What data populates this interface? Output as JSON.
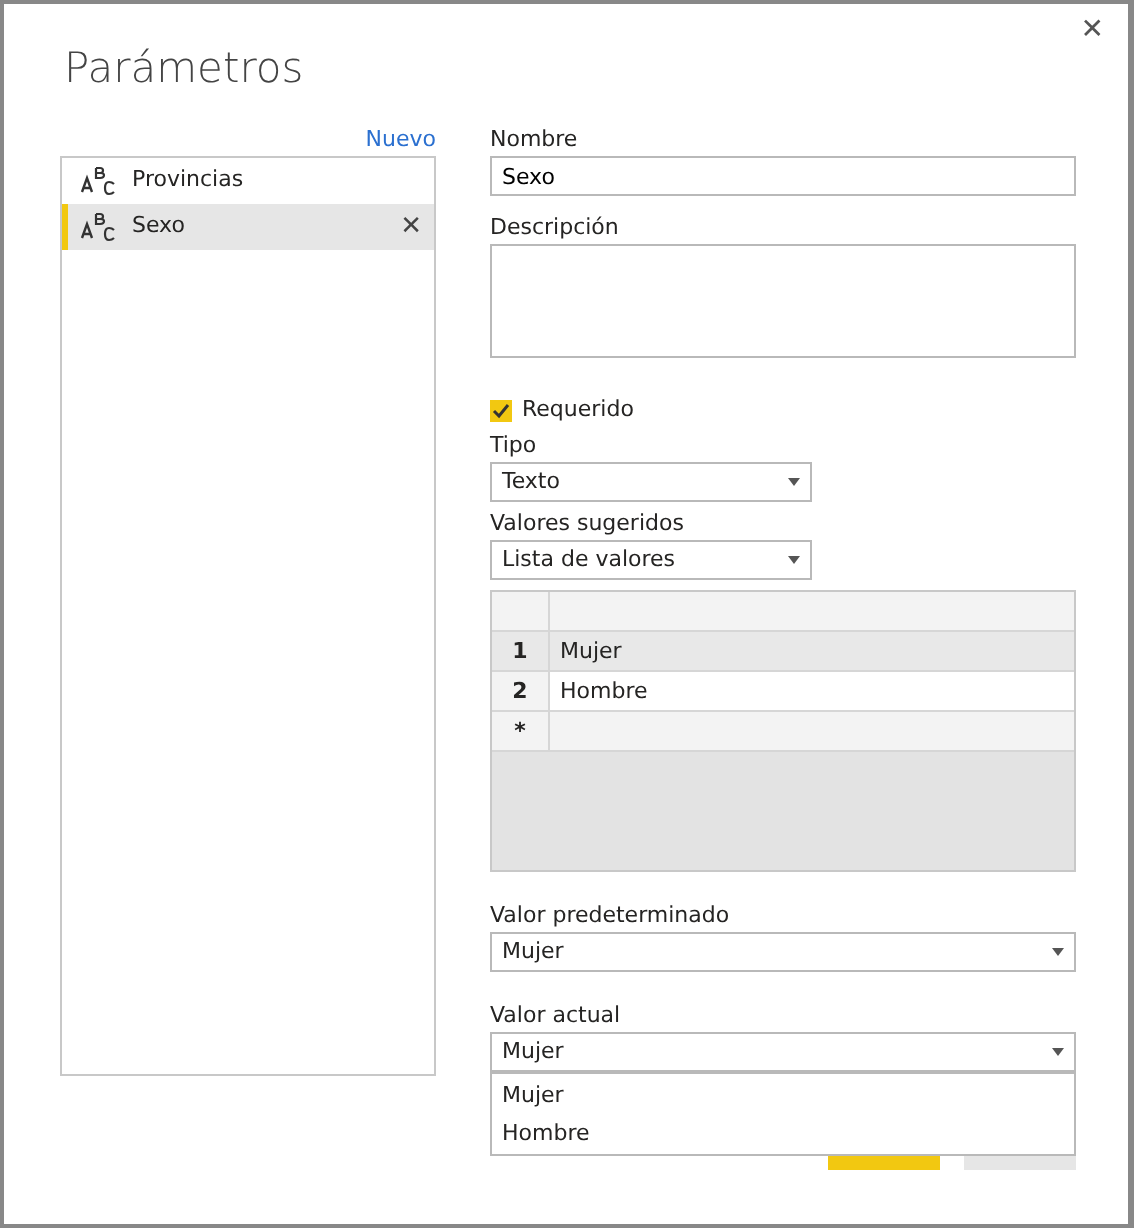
{
  "title": "Parámetros",
  "close": "✕",
  "new_link": "Nuevo",
  "parameters": [
    {
      "name": "Provincias",
      "selected": false
    },
    {
      "name": "Sexo",
      "selected": true
    }
  ],
  "delete_glyph": "✕",
  "form": {
    "name_label": "Nombre",
    "name_value": "Sexo",
    "description_label": "Descripción",
    "required": {
      "label": "Requerido",
      "checked": true
    },
    "type_label": "Tipo",
    "type_value": "Texto",
    "suggested_label": "Valores sugeridos",
    "suggested_value": "Lista de valores",
    "values_table": {
      "rows": [
        {
          "index": "1",
          "value": "Mujer",
          "selected": true
        },
        {
          "index": "2",
          "value": "Hombre",
          "selected": false
        }
      ],
      "new_row_marker": "*"
    },
    "default_label": "Valor predeterminado",
    "default_value": "Mujer",
    "current_label": "Valor actual",
    "current_value": "Mujer",
    "current_dropdown": {
      "expanded": true,
      "options": [
        "Mujer",
        "Hombre"
      ]
    }
  },
  "buttons": [
    {
      "kind": "primary"
    },
    {
      "kind": "secondary"
    }
  ]
}
